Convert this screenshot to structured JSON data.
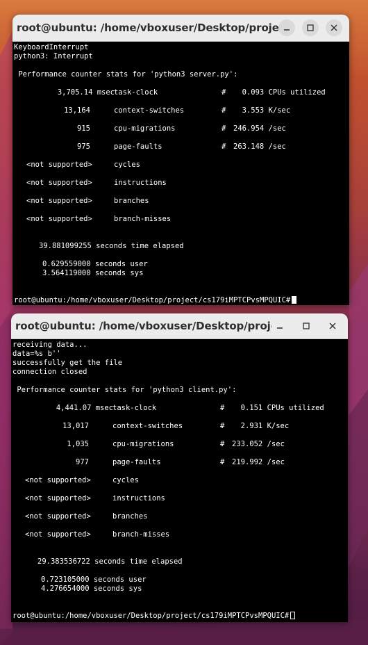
{
  "windows": [
    {
      "title": "root@ubuntu: /home/vboxuser/Desktop/project/cs...",
      "controls": {
        "minimize": "minimize-icon",
        "maximize": "maximize-icon",
        "close": "close-icon"
      },
      "terminal": {
        "preamble": [
          "KeyboardInterrupt",
          "python3: Interrupt"
        ],
        "header": " Performance counter stats for 'python3 server.py':",
        "stats": [
          {
            "value": "3,705.14 msec",
            "event": "task-clock",
            "hash": "#",
            "comment": "  0.093 CPUs utilized"
          },
          {
            "value": "13,164",
            "event": "context-switches",
            "hash": "#",
            "comment": "  3.553 K/sec"
          },
          {
            "value": "915",
            "event": "cpu-migrations",
            "hash": "#",
            "comment": "246.954 /sec"
          },
          {
            "value": "975",
            "event": "page-faults",
            "hash": "#",
            "comment": "263.148 /sec"
          },
          {
            "value": "<not supported>",
            "event": "cycles",
            "hash": "",
            "comment": ""
          },
          {
            "value": "<not supported>",
            "event": "instructions",
            "hash": "",
            "comment": ""
          },
          {
            "value": "<not supported>",
            "event": "branches",
            "hash": "",
            "comment": ""
          },
          {
            "value": "<not supported>",
            "event": "branch-misses",
            "hash": "",
            "comment": ""
          }
        ],
        "elapsed": "39.881099255 seconds time elapsed",
        "user": "0.629559000 seconds user",
        "sys": "3.564119000 seconds sys",
        "prompt": "root@ubuntu:/home/vboxuser/Desktop/project/cs179iMPTCPvsMPQUIC#"
      }
    },
    {
      "title": "root@ubuntu: /home/vboxuser/Desktop/project/cs...",
      "controls": {
        "minimize": "minimize-icon",
        "maximize": "maximize-icon",
        "close": "close-icon"
      },
      "terminal": {
        "preamble": [
          "receiving data...",
          "data=%s b''",
          "successfully get the file",
          "connection closed"
        ],
        "header": " Performance counter stats for 'python3 client.py':",
        "stats": [
          {
            "value": "4,441.07 msec",
            "event": "task-clock",
            "hash": "#",
            "comment": "  0.151 CPUs utilized"
          },
          {
            "value": "13,017",
            "event": "context-switches",
            "hash": "#",
            "comment": "  2.931 K/sec"
          },
          {
            "value": "1,035",
            "event": "cpu-migrations",
            "hash": "#",
            "comment": "233.052 /sec"
          },
          {
            "value": "977",
            "event": "page-faults",
            "hash": "#",
            "comment": "219.992 /sec"
          },
          {
            "value": "<not supported>",
            "event": "cycles",
            "hash": "",
            "comment": ""
          },
          {
            "value": "<not supported>",
            "event": "instructions",
            "hash": "",
            "comment": ""
          },
          {
            "value": "<not supported>",
            "event": "branches",
            "hash": "",
            "comment": ""
          },
          {
            "value": "<not supported>",
            "event": "branch-misses",
            "hash": "",
            "comment": ""
          }
        ],
        "elapsed": "29.383536722 seconds time elapsed",
        "user": "0.723105000 seconds user",
        "sys": "4.276654000 seconds sys",
        "prompt": "root@ubuntu:/home/vboxuser/Desktop/project/cs179iMPTCPvsMPQUIC#"
      }
    }
  ],
  "colors": {
    "terminal_bg": "#000000",
    "terminal_fg": "#ffffff",
    "titlebar_bg": "#ececec"
  }
}
